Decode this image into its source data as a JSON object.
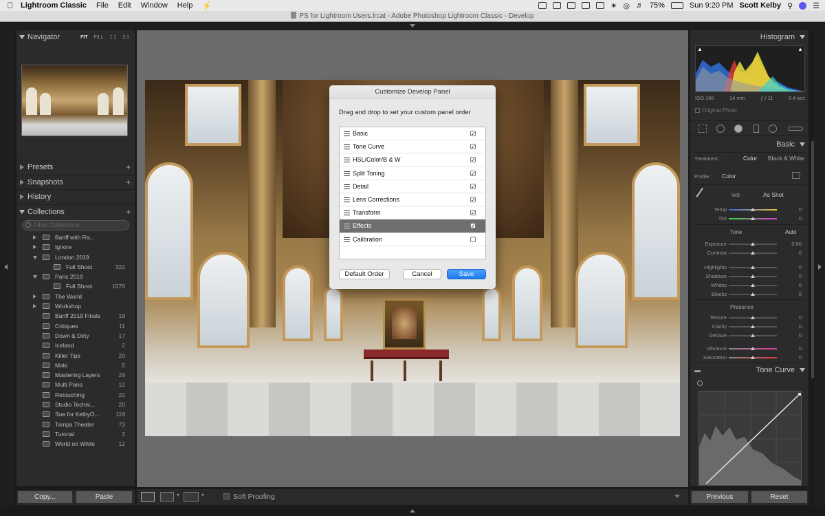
{
  "menubar": {
    "app_name": "Lightroom Classic",
    "menus": [
      "File",
      "Edit",
      "Window",
      "Help"
    ],
    "battery": "75%",
    "clock": "Sun 9:20 PM",
    "user": "Scott Kelby"
  },
  "window": {
    "title": "PS for Lightroom Users.lrcat - Adobe Photoshop Lightroom Classic - Develop"
  },
  "left_panel": {
    "navigator": {
      "title": "Navigator",
      "zoom_options": [
        "FIT",
        "FILL",
        "1:1",
        "2:1"
      ]
    },
    "presets": "Presets",
    "snapshots": "Snapshots",
    "history": "History",
    "collections": {
      "title": "Collections",
      "filter_placeholder": "Filter Collections",
      "items": [
        {
          "label": "Banff with Ra...",
          "count": "",
          "kind": "set",
          "level": 0,
          "open": false
        },
        {
          "label": "Ignore",
          "count": "",
          "kind": "set",
          "level": 0,
          "open": false
        },
        {
          "label": "London 2019",
          "count": "",
          "kind": "set",
          "level": 0,
          "open": true
        },
        {
          "label": "Full Shoot",
          "count": "322",
          "kind": "collection",
          "level": 1,
          "open": false
        },
        {
          "label": "Paris 2019",
          "count": "",
          "kind": "set",
          "level": 0,
          "open": true
        },
        {
          "label": "Full Shoot",
          "count": "1576",
          "kind": "collection",
          "level": 1,
          "open": false
        },
        {
          "label": "The World",
          "count": "",
          "kind": "set",
          "level": 0,
          "open": false
        },
        {
          "label": "Workshop",
          "count": "",
          "kind": "set",
          "level": 0,
          "open": false
        },
        {
          "label": "Banff 2019 Finals",
          "count": "18",
          "kind": "collection",
          "level": 0,
          "open": false
        },
        {
          "label": "Critiques",
          "count": "11",
          "kind": "collection",
          "level": 0,
          "open": false
        },
        {
          "label": "Down & Dirty",
          "count": "17",
          "kind": "collection",
          "level": 0,
          "open": false
        },
        {
          "label": "Iceland",
          "count": "2",
          "kind": "collection",
          "level": 0,
          "open": false
        },
        {
          "label": "Killer Tips",
          "count": "20",
          "kind": "collection",
          "level": 0,
          "open": false
        },
        {
          "label": "Maki",
          "count": "5",
          "kind": "collection",
          "level": 0,
          "open": false
        },
        {
          "label": "Mastering Layers",
          "count": "29",
          "kind": "collection",
          "level": 0,
          "open": false
        },
        {
          "label": "Multi Pano",
          "count": "12",
          "kind": "collection",
          "level": 0,
          "open": false
        },
        {
          "label": "Retouching",
          "count": "22",
          "kind": "collection",
          "level": 0,
          "open": false
        },
        {
          "label": "Studio Techni...",
          "count": "20",
          "kind": "collection",
          "level": 0,
          "open": false
        },
        {
          "label": "Sue for KelbyO...",
          "count": "119",
          "kind": "collection",
          "level": 0,
          "open": false
        },
        {
          "label": "Tampa Theater",
          "count": "73",
          "kind": "collection",
          "level": 0,
          "open": false
        },
        {
          "label": "Tutorial",
          "count": "2",
          "kind": "collection",
          "level": 0,
          "open": false
        },
        {
          "label": "World on White",
          "count": "12",
          "kind": "collection",
          "level": 0,
          "open": false
        }
      ]
    },
    "copy_label": "Copy...",
    "paste_label": "Paste"
  },
  "dialog": {
    "title": "Customize Develop Panel",
    "subtitle": "Drag and drop to set your custom panel order",
    "items": [
      {
        "label": "Basic",
        "checked": true,
        "selected": false
      },
      {
        "label": "Tone Curve",
        "checked": true,
        "selected": false
      },
      {
        "label": "HSL/Color/B & W",
        "checked": true,
        "selected": false
      },
      {
        "label": "Split Toning",
        "checked": true,
        "selected": false
      },
      {
        "label": "Detail",
        "checked": true,
        "selected": false
      },
      {
        "label": "Lens Corrections",
        "checked": true,
        "selected": false
      },
      {
        "label": "Transform",
        "checked": true,
        "selected": false
      },
      {
        "label": "Effects",
        "checked": true,
        "selected": true
      },
      {
        "label": "Calibration",
        "checked": false,
        "selected": false
      }
    ],
    "default_order_label": "Default Order",
    "cancel_label": "Cancel",
    "save_label": "Save"
  },
  "toolbar": {
    "soft_proofing": "Soft Proofing"
  },
  "right_panel": {
    "histogram": {
      "title": "Histogram",
      "iso": "ISO 100",
      "focal": "14 mm",
      "aperture": "ƒ / 11",
      "shutter": "0.4 sec",
      "original_photo": "Original Photo"
    },
    "basic": {
      "title": "Basic",
      "treatment_label": "Treatment :",
      "treatment_color": "Color",
      "treatment_bw": "Black & White",
      "profile_label": "Profile :",
      "profile_value": "Color",
      "wb_label": "WB :",
      "wb_value": "As Shot",
      "tone_label": "Tone",
      "auto_label": "Auto",
      "presence_label": "Presence",
      "sliders": [
        {
          "label": "Temp",
          "value": "0",
          "pos": 0.5
        },
        {
          "label": "Tint",
          "value": "0",
          "pos": 0.5
        },
        {
          "label": "Exposure",
          "value": "0.00",
          "pos": 0.5
        },
        {
          "label": "Contrast",
          "value": "0",
          "pos": 0.5
        },
        {
          "label": "Highlights",
          "value": "0",
          "pos": 0.5
        },
        {
          "label": "Shadows",
          "value": "0",
          "pos": 0.5
        },
        {
          "label": "Whites",
          "value": "0",
          "pos": 0.5
        },
        {
          "label": "Blacks",
          "value": "0",
          "pos": 0.5
        },
        {
          "label": "Texture",
          "value": "0",
          "pos": 0.5
        },
        {
          "label": "Clarity",
          "value": "0",
          "pos": 0.5
        },
        {
          "label": "Dehaze",
          "value": "0",
          "pos": 0.5
        },
        {
          "label": "Vibrance",
          "value": "0",
          "pos": 0.5
        },
        {
          "label": "Saturation",
          "value": "0",
          "pos": 0.5
        }
      ]
    },
    "tone_curve": {
      "title": "Tone Curve"
    },
    "previous_label": "Previous",
    "reset_label": "Reset"
  }
}
